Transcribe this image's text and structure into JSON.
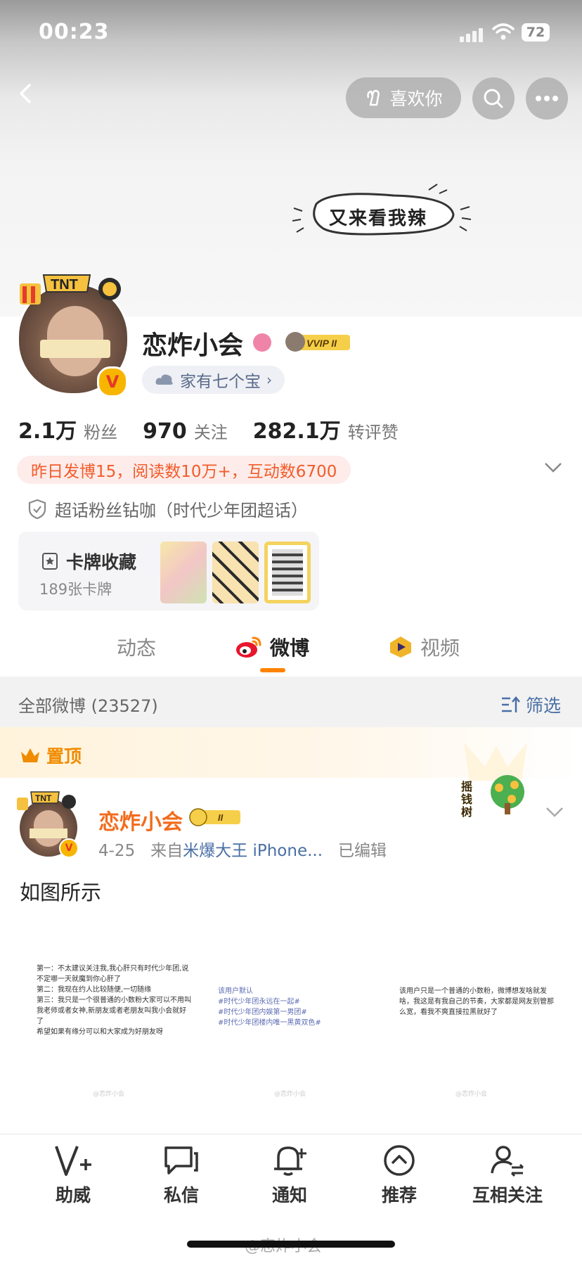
{
  "status": {
    "time": "00:23",
    "battery": "72"
  },
  "header": {
    "like_button": "喜欢你"
  },
  "cover": {
    "sticker_text": "又来看我辣"
  },
  "profile": {
    "name": "恋炸小会",
    "vip_label": "VVIP II",
    "tag": "家有七个宝",
    "stats": [
      {
        "num": "2.1万",
        "label": "粉丝"
      },
      {
        "num": "970",
        "label": "关注"
      },
      {
        "num": "282.1万",
        "label": "转评赞"
      }
    ],
    "banner": "昨日发博15，阅读数10万+，互动数6700",
    "super_topic": "超话粉丝钻咖（时代少年团超话）",
    "cards": {
      "title": "卡牌收藏",
      "count": "189张卡牌"
    }
  },
  "tabs": [
    "动态",
    "微博",
    "视频"
  ],
  "filter": {
    "label": "全部微博 (23527)",
    "button": "筛选"
  },
  "pinned": {
    "label": "置顶"
  },
  "post": {
    "author": "恋炸小会",
    "date": "4-25",
    "from_prefix": "来自",
    "source": "米爆大王 iPhone...",
    "edited": "已编辑",
    "text": "如图所示",
    "tree_label": "摇钱树",
    "images": [
      {
        "text": "第一：不太建议关注我,我心肝只有时代少年团,说不定哪一天就魔到你心肝了\n第二：我现在约人比较随便,一切随缘\n第三：我只是一个很普通的小数粉大家可以不用叫我老师或者女神,新朋友或者老朋友叫我小会就好了\n希望如果有缘分可以和大家成为好朋友呀"
      },
      {
        "text": "该用户默认\n#时代少年团永远在一起#\n#时代少年团内娱第一男团#\n#时代少年团楼内唯一黑黄双色#"
      },
      {
        "text": "该用户只是一个普通的小数粉，微博想发啥就发啥，我这是有我自己的节奏，大家都是网友别管那么宽，看我不爽直接拉黑就好了"
      }
    ],
    "watermark": "@恋炸小会"
  },
  "bottom_nav": [
    "助威",
    "私信",
    "通知",
    "推荐",
    "互相关注"
  ],
  "footer_watermark": "@恋炸小会",
  "colors": {
    "accent_orange": "#ff8200",
    "link_blue": "#4a6fa5",
    "name_orange": "#f26c1c"
  }
}
